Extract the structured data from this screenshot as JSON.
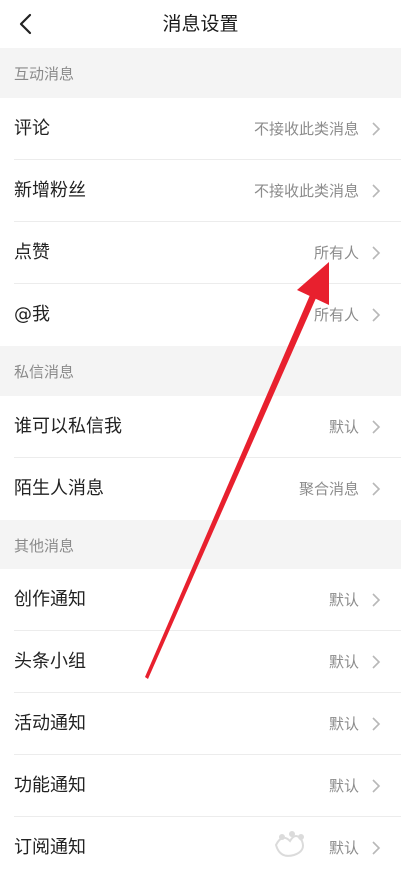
{
  "header": {
    "title": "消息设置",
    "back_icon": "back-chevron-icon"
  },
  "sections": [
    {
      "title": "互动消息",
      "items": [
        {
          "label": "评论",
          "value": "不接收此类消息"
        },
        {
          "label": "新增粉丝",
          "value": "不接收此类消息"
        },
        {
          "label": "点赞",
          "value": "所有人"
        },
        {
          "label": "@我",
          "value": "所有人"
        }
      ]
    },
    {
      "title": "私信消息",
      "items": [
        {
          "label": "谁可以私信我",
          "value": "默认"
        },
        {
          "label": "陌生人消息",
          "value": "聚合消息"
        }
      ]
    },
    {
      "title": "其他消息",
      "items": [
        {
          "label": "创作通知",
          "value": "默认"
        },
        {
          "label": "头条小组",
          "value": "默认"
        },
        {
          "label": "活动通知",
          "value": "默认"
        },
        {
          "label": "功能通知",
          "value": "默认"
        },
        {
          "label": "订阅通知",
          "value": "默认"
        }
      ]
    }
  ],
  "annotation": {
    "arrow_color": "#e8202e"
  }
}
